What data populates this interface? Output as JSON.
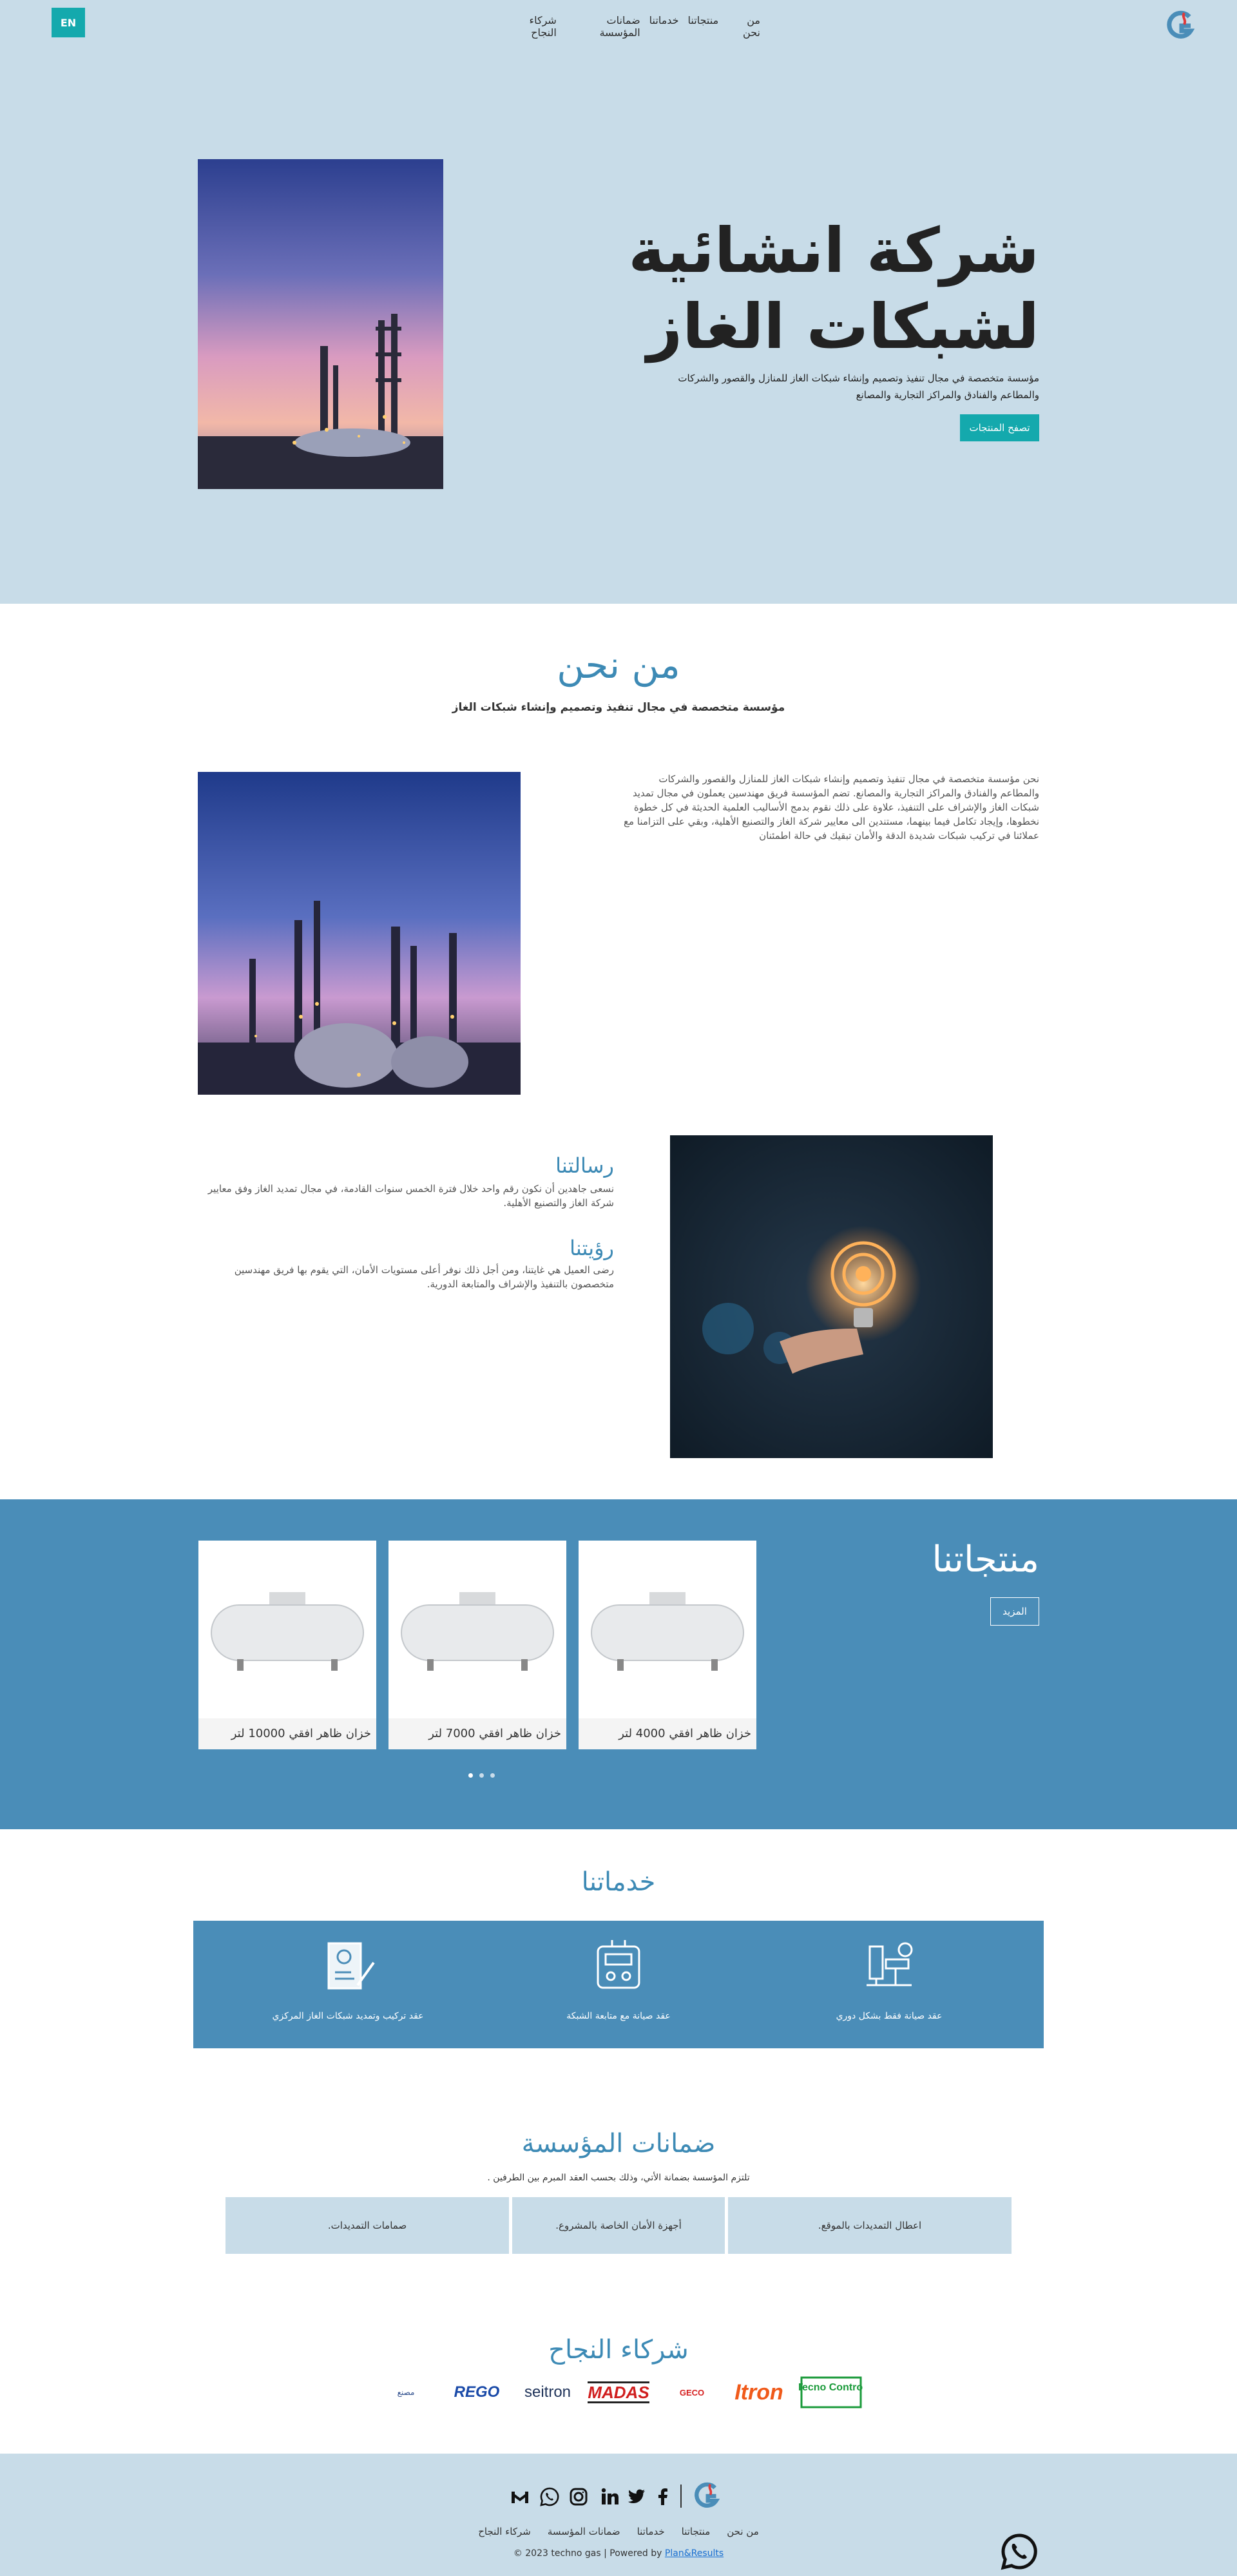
{
  "brand": {
    "lang_label": "EN",
    "accent": "#14a9ad",
    "blue": "#4a8db8",
    "light_blue": "#c8dce8",
    "title_blue": "#3d8ab5"
  },
  "nav": {
    "items": [
      "من نحن",
      "منتجاتنا",
      "خدماتنا",
      "ضمانات المؤسسة",
      "شركاء النجاح"
    ]
  },
  "hero": {
    "title_line1": "شركة انشائية",
    "title_line2": "لشبكات الغاز",
    "description": "مؤسسة متخصصة في مجال تنفيذ وتصميم وإنشاء شبكات الغاز للمنازل والقصور والشركات والمطاعم والفنادق والمراكز التجارية والمصانع",
    "button": "تصفح المنتجات"
  },
  "about": {
    "title": "من نحن",
    "subtitle": "مؤسسة متخصصة في مجال تنفيذ وتصميم وإنشاء شبكات الغاز",
    "text": "نحن مؤسسة متخصصة في مجال تنفيذ وتصميم وإنشاء شبكات الغاز للمنازل والقصور والشركات والمطاعم والفنادق والمراكز التجارية والمصانع. تضم المؤسسة فريق مهندسين يعملون في مجال تمديد شبكات الغاز والإشراف على التنفيذ، علاوة على ذلك نقوم بدمج الأساليب العلمية الحديثة في كل خطوة نخطوها، وإيجاد تكامل فيما بينهما، مستندين الى معايير شركة الغاز والتصنيع الأهلية، وبقي على التزامنا مع عملائنا في تركيب شبكات شديدة الدقة والأمان تبقيك في حالة اطمئنان",
    "mission_title": "رسالتنا",
    "mission_text": "نسعى جاهدين أن نكون رقم واحد خلال فترة الخمس سنوات القادمة، في مجال تمديد الغاز وفق معايير شركة الغاز والتصنيع الأهلية.",
    "vision_title": "رؤيتنا",
    "vision_text": "رضى العميل هي غايتنا، ومن أجل ذلك نوفر أعلى مستويات الأمان، التي يقوم بها فريق مهندسين متخصصون بالتنفيذ والإشراف والمتابعة الدورية."
  },
  "products": {
    "title": "منتجاتنا",
    "more": "المزيد",
    "items": [
      {
        "name": "خزان ظاهر افقي 4000 لتر"
      },
      {
        "name": "خزان ظاهر افقي 7000 لتر"
      },
      {
        "name": "خزان ظاهر افقي 10000 لتر"
      }
    ],
    "pages": 3,
    "active_page": 1
  },
  "services": {
    "title": "خدماتنا",
    "items": [
      {
        "label": "عقد صيانة فقط بشكل دوري",
        "icon": "valve-pipe-icon"
      },
      {
        "label": "عقد صيانة مع متابعة الشبكة",
        "icon": "meter-icon"
      },
      {
        "label": "عقد تركيب وتمديد شبكات الغاز المركزي",
        "icon": "contract-tools-icon"
      }
    ]
  },
  "guarantees": {
    "title": "ضمانات المؤسسة",
    "subtitle": "تلتزم المؤسسة بضمانة الأتي، وذلك بحسب العقد المبرم بين الطرفين .",
    "items": [
      "اعطال التمديدات بالموقع.",
      "أجهزة الأمان الخاصة بالمشروع.",
      "صمامات التمديدات."
    ]
  },
  "partners": {
    "title": "شركاء النجاح",
    "logos": [
      "Tecno Control",
      "Itron",
      "GECO",
      "MADAS",
      "seitron",
      "REGO",
      "مصنع"
    ]
  },
  "footer": {
    "nav": [
      "من نحن",
      "منتجاتنا",
      "خدماتنا",
      "ضمانات المؤسسة",
      "شركاء النجاح"
    ],
    "copyright": "© 2023 techno gas | Powered by",
    "powered_link": "Plan&Results",
    "social": [
      "facebook-icon",
      "twitter-icon",
      "linkedin-icon",
      "instagram-icon",
      "whatsapp-icon",
      "gmail-icon"
    ]
  }
}
